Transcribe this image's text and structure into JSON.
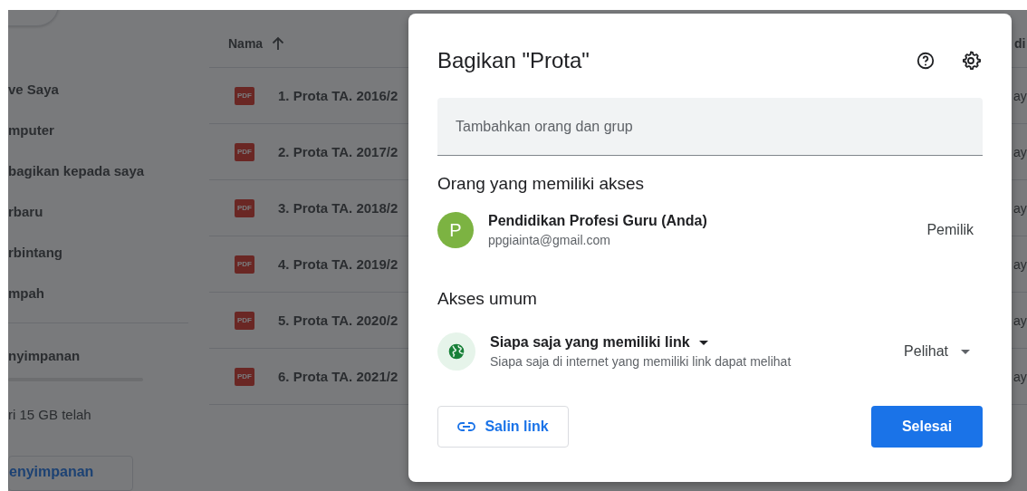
{
  "sidebar": {
    "items": [
      {
        "label": "ve Saya"
      },
      {
        "label": "mputer"
      },
      {
        "label": "bagikan kepada saya"
      },
      {
        "label": "rbaru"
      },
      {
        "label": "rbintang"
      },
      {
        "label": "mpah"
      }
    ],
    "storage_label": "nyimpanan",
    "storage_usage": "ri 15 GB telah",
    "storage_button": "enyimpanan"
  },
  "file_list": {
    "columns": [
      {
        "label": "Nama",
        "ascending": true
      },
      {
        "label": "di"
      }
    ],
    "rows": [
      {
        "name": "1. Prota TA. 2016/2",
        "type": "PDF",
        "column_2": "ay"
      },
      {
        "name": "2. Prota TA. 2017/2",
        "type": "PDF",
        "column_2": "ay"
      },
      {
        "name": "3. Prota TA. 2018/2",
        "type": "PDF",
        "column_2": "ay"
      },
      {
        "name": "4. Prota TA. 2019/2",
        "type": "PDF",
        "column_2": "ay"
      },
      {
        "name": "5. Prota TA. 2020/2",
        "type": "PDF",
        "column_2": "ay"
      },
      {
        "name": "6. Prota TA. 2021/2",
        "type": "PDF",
        "column_2": "ay"
      }
    ]
  },
  "dialog": {
    "title": "Bagikan \"Prota\"",
    "add_field": {
      "placeholder": "Tambahkan orang dan grup"
    },
    "people_heading": "Orang yang memiliki akses",
    "people": [
      {
        "initial": "P",
        "name": "Pendidikan Profesi Guru (Anda)",
        "email": "ppgiainta@gmail.com",
        "role": "Pemilik"
      }
    ],
    "general_heading": "Akses umum",
    "general_access": {
      "audience": "Siapa saja yang memiliki link",
      "description": "Siapa saja di internet yang memiliki link dapat melihat",
      "role": "Pelihat"
    },
    "copy_link": "Salin link",
    "done": "Selesai"
  }
}
